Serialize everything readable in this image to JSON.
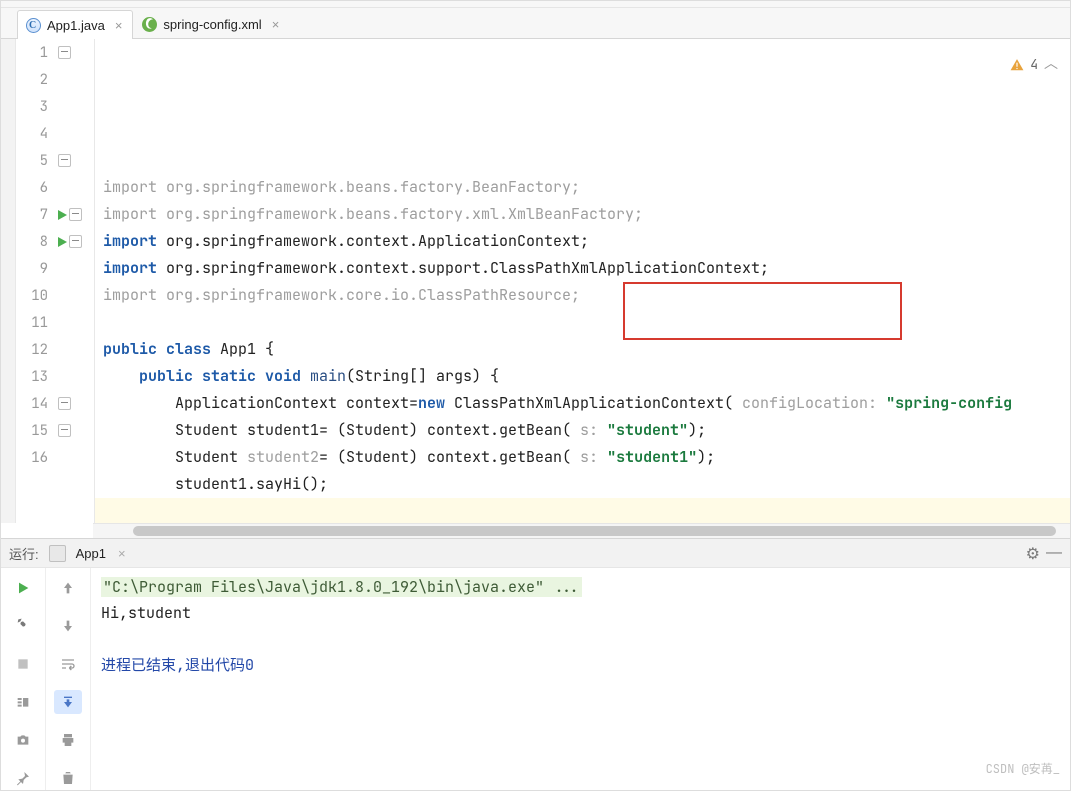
{
  "tabs": [
    {
      "label": "App1.java",
      "icon": "c-icon",
      "active": true
    },
    {
      "label": "spring-config.xml",
      "icon": "xml-icon",
      "active": false
    }
  ],
  "warnings": {
    "count": "4"
  },
  "code": {
    "lines": [
      {
        "n": "1",
        "segs": [
          {
            "t": "import ",
            "c": "grey"
          },
          {
            "t": "org.springframework.beans.factory.BeanFactory;",
            "c": "grey"
          }
        ],
        "fold": true
      },
      {
        "n": "2",
        "segs": [
          {
            "t": "import ",
            "c": "grey"
          },
          {
            "t": "org.springframework.beans.factory.xml.XmlBeanFactory;",
            "c": "grey"
          }
        ]
      },
      {
        "n": "3",
        "segs": [
          {
            "t": "import ",
            "c": "kw"
          },
          {
            "t": "org.springframework.context.ApplicationContext;",
            "c": ""
          }
        ]
      },
      {
        "n": "4",
        "segs": [
          {
            "t": "import ",
            "c": "kw"
          },
          {
            "t": "org.springframework.context.support.ClassPathXmlApplicationContext;",
            "c": ""
          }
        ]
      },
      {
        "n": "5",
        "segs": [
          {
            "t": "import ",
            "c": "grey"
          },
          {
            "t": "org.springframework.core.io.ClassPathResource;",
            "c": "grey"
          }
        ],
        "fold": true
      },
      {
        "n": "6",
        "segs": [
          {
            "t": " ",
            "c": ""
          }
        ]
      },
      {
        "n": "7",
        "run": true,
        "fold": true,
        "segs": [
          {
            "t": "public class ",
            "c": "kw"
          },
          {
            "t": "App1 {",
            "c": ""
          }
        ]
      },
      {
        "n": "8",
        "run": true,
        "fold": true,
        "segs": [
          {
            "t": "    public static void ",
            "c": "kw"
          },
          {
            "t": "main",
            "c": "fn"
          },
          {
            "t": "(String[] args) {",
            "c": ""
          }
        ]
      },
      {
        "n": "9",
        "segs": [
          {
            "t": "        ApplicationContext context=",
            "c": ""
          },
          {
            "t": "new ",
            "c": "kw"
          },
          {
            "t": "ClassPathXmlApplicationContext( ",
            "c": ""
          },
          {
            "t": "configLocation:",
            "c": "hint"
          },
          {
            "t": " ",
            "c": ""
          },
          {
            "t": "\"spring-config",
            "c": "str"
          }
        ]
      },
      {
        "n": "10",
        "segs": [
          {
            "t": "        Student student1= (Student) context.getBean( ",
            "c": ""
          },
          {
            "t": "s:",
            "c": "hint"
          },
          {
            "t": " ",
            "c": ""
          },
          {
            "t": "\"student\"",
            "c": "str"
          },
          {
            "t": ");",
            "c": ""
          }
        ]
      },
      {
        "n": "11",
        "segs": [
          {
            "t": "        Student ",
            "c": ""
          },
          {
            "t": "student2",
            "c": "grey"
          },
          {
            "t": "= (Student) context.getBean( ",
            "c": ""
          },
          {
            "t": "s:",
            "c": "hint"
          },
          {
            "t": " ",
            "c": ""
          },
          {
            "t": "\"student1\"",
            "c": "str"
          },
          {
            "t": ");",
            "c": ""
          }
        ]
      },
      {
        "n": "12",
        "segs": [
          {
            "t": "        student1.sayHi();",
            "c": ""
          }
        ]
      },
      {
        "n": "13",
        "caret": true,
        "segs": [
          {
            "t": " ",
            "c": ""
          }
        ]
      },
      {
        "n": "14",
        "fold": true,
        "segs": [
          {
            "t": "    }",
            "c": ""
          }
        ]
      },
      {
        "n": "15",
        "fold": true,
        "segs": [
          {
            "t": "}",
            "c": ""
          }
        ]
      },
      {
        "n": "16",
        "segs": [
          {
            "t": " ",
            "c": ""
          }
        ]
      }
    ]
  },
  "run": {
    "title": "运行:",
    "config": "App1",
    "cmd": "\"C:\\Program Files\\Java\\jdk1.8.0_192\\bin\\java.exe\" ...",
    "out1": "Hi,student",
    "exit": "进程已结束,退出代码0"
  },
  "watermark": "CSDN @安苒_"
}
